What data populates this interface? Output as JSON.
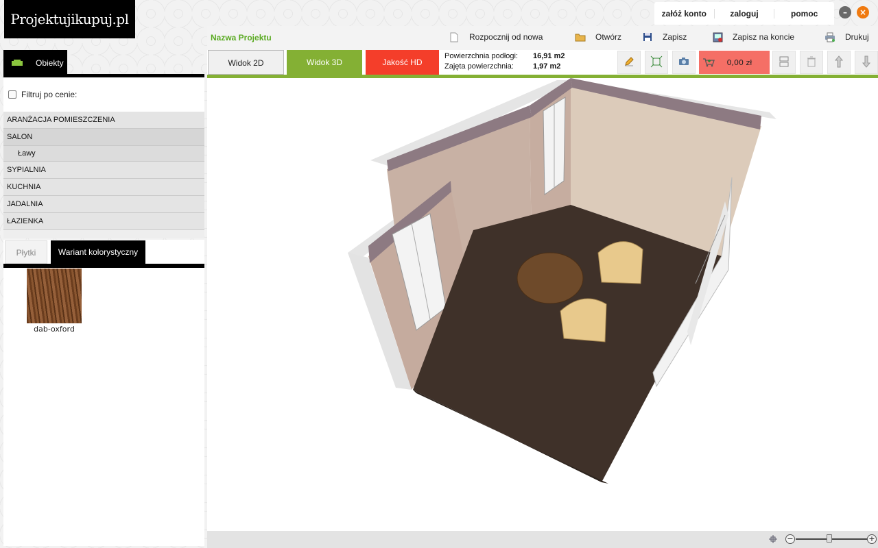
{
  "header": {
    "logo_text": "Projektujikupuj.pl",
    "links": [
      "załóż konto",
      "zaloguj",
      "pomoc"
    ],
    "window_controls": {
      "minimize": "–",
      "close": "×"
    }
  },
  "toolbar": {
    "project_name": "Nazwa Projektu",
    "menu": {
      "restart": "Rozpocznij od nowa",
      "open": "Otwórz",
      "save": "Zapisz",
      "save_account": "Zapisz na koncie",
      "print": "Drukuj"
    }
  },
  "views": {
    "view_2d": "Widok 2D",
    "view_3d": "Widok 3D",
    "hd": "Jakość HD"
  },
  "area": {
    "floor_label": "Powierzchnia podłogi:",
    "floor_value": "16,91 m2",
    "occupied_label": "Zajęta powierzchnia:",
    "occupied_value": "1,97 m2"
  },
  "price": "0,00 zł",
  "sidebar": {
    "objects_tab": "Obiekty",
    "filter_label": "Filtruj po cenie:",
    "categories": [
      "ARANŻACJA POMIESZCZENIA",
      "SALON",
      "Ławy",
      "SYPIALNIA",
      "KUCHNIA",
      "JADALNIA",
      "ŁAZIENKA"
    ],
    "tabs": [
      "Płytki",
      "Wariant kolorystyczny"
    ],
    "swatch_label": "dab-oxford"
  },
  "zoom": {
    "minus": "−",
    "plus": "+",
    "level": 0.45
  },
  "colors": {
    "accent_green": "#84b034",
    "hd_red": "#f43e2a",
    "price_bg": "#f56f66",
    "orange_close": "#f07a10"
  }
}
